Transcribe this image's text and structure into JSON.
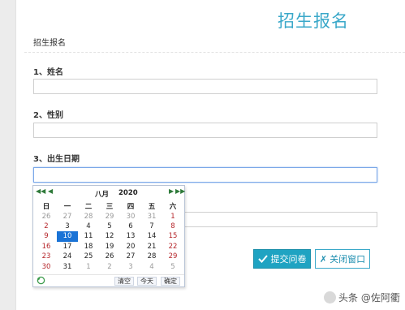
{
  "page": {
    "title": "招生报名",
    "form_name": "招生报名"
  },
  "questions": [
    {
      "label": "1、姓名",
      "value": ""
    },
    {
      "label": "2、性别",
      "value": ""
    },
    {
      "label": "3、出生日期",
      "value": ""
    },
    {
      "label": "",
      "value": ""
    }
  ],
  "buttons": {
    "submit": "提交问卷",
    "close": "关闭窗口"
  },
  "calendar": {
    "prev_year": "◀◀",
    "prev_month": "◀",
    "next_month": "▶",
    "next_year": "▶▶",
    "month": "八月",
    "year": "2020",
    "weekdays": [
      "日",
      "一",
      "二",
      "三",
      "四",
      "五",
      "六"
    ],
    "weeks": [
      [
        "26",
        "27",
        "28",
        "29",
        "30",
        "31",
        "1"
      ],
      [
        "2",
        "3",
        "4",
        "5",
        "6",
        "7",
        "8"
      ],
      [
        "9",
        "10",
        "11",
        "12",
        "13",
        "14",
        "15"
      ],
      [
        "16",
        "17",
        "18",
        "19",
        "20",
        "21",
        "22"
      ],
      [
        "23",
        "24",
        "25",
        "26",
        "27",
        "28",
        "29"
      ],
      [
        "30",
        "31",
        "1",
        "2",
        "3",
        "4",
        "5"
      ]
    ],
    "selected": "10",
    "footer": {
      "clear": "清空",
      "today": "今天",
      "confirm": "确定"
    }
  },
  "watermark": "头条 @佐阿衢",
  "colors": {
    "accent": "#1fa3c2",
    "title": "#3aa8c9",
    "selected_day": "#1a73d6",
    "weekend": "#b5252a"
  }
}
